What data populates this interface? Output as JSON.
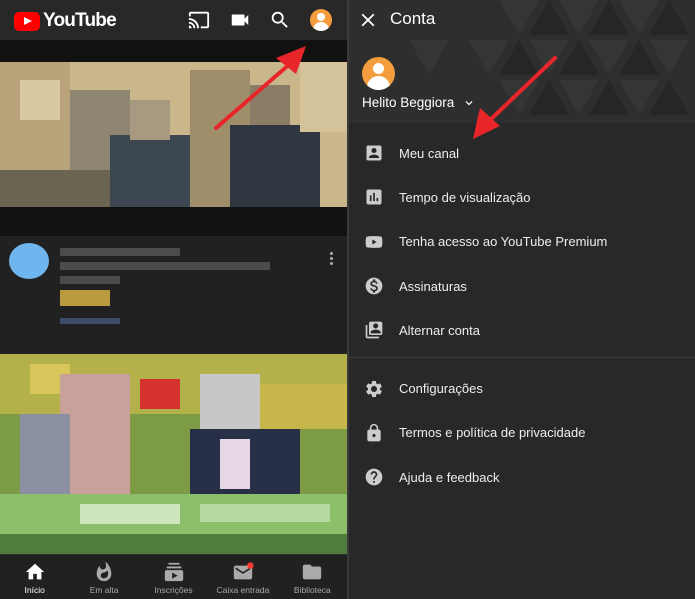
{
  "left": {
    "app_name": "YouTube",
    "icons": {
      "cast": "cast-icon",
      "camera": "video-camera-icon",
      "search": "search-icon",
      "account": "account-avatar-icon"
    },
    "bottom_nav": [
      {
        "label": "Início",
        "icon": "home-icon",
        "active": true
      },
      {
        "label": "Em alta",
        "icon": "flame-icon",
        "active": false
      },
      {
        "label": "Inscrições",
        "icon": "subscriptions-icon",
        "active": false
      },
      {
        "label": "Caixa entrada",
        "icon": "inbox-icon",
        "active": false
      },
      {
        "label": "Biblioteca",
        "icon": "folder-icon",
        "active": false
      }
    ]
  },
  "account": {
    "title": "Conta",
    "user_name": "Helito Beggiora",
    "menu_primary": [
      {
        "label": "Meu canal",
        "icon": "channel-icon"
      },
      {
        "label": "Tempo de visualização",
        "icon": "bar-chart-icon"
      },
      {
        "label": "Tenha acesso ao YouTube Premium",
        "icon": "youtube-play-icon"
      },
      {
        "label": "Assinaturas",
        "icon": "dollar-icon"
      },
      {
        "label": "Alternar conta",
        "icon": "switch-account-icon"
      }
    ],
    "menu_secondary": [
      {
        "label": "Configurações",
        "icon": "gear-icon"
      },
      {
        "label": "Termos e política de privacidade",
        "icon": "lock-icon"
      },
      {
        "label": "Ajuda e feedback",
        "icon": "help-icon"
      }
    ]
  },
  "colors": {
    "brand_red": "#ff0000",
    "avatar_orange": "#f49d3e",
    "annotation_arrow": "#e8262a",
    "background": "#282828"
  }
}
